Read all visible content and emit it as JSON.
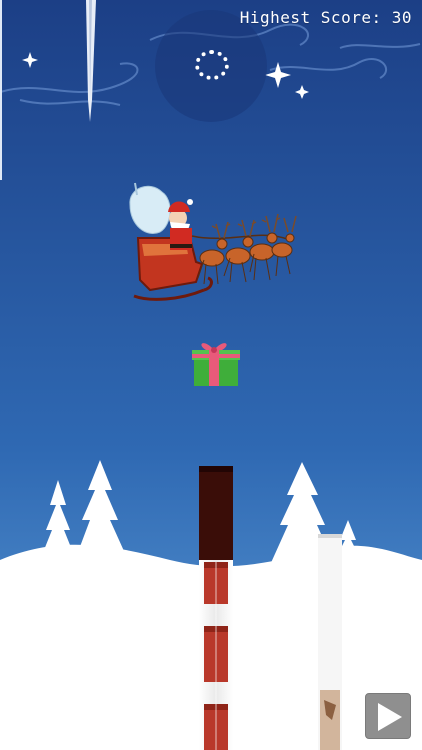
{
  "hud": {
    "highest_score_label": "Highest Score:",
    "highest_score_value": "30",
    "highest_score_text": "Highest Score: 30"
  },
  "controls": {
    "pause_icon": "ring-icon",
    "play_icon": "play-triangle-icon"
  },
  "colors": {
    "sky_top": "#1c3f86",
    "sky_bottom": "#5c9bd6",
    "snow": "#ffffff",
    "chimney_dark": "#3a0d08",
    "chimney_brick": "#b9382a",
    "present_green": "#3fae3a",
    "present_ribbon": "#e85a7a"
  },
  "sprites": {
    "player": "santa-sleigh-with-reindeer",
    "pickup": "gift-box-icon",
    "obstacles": [
      "icicle",
      "chimney-pipe",
      "chimney-pipe-partial"
    ]
  }
}
